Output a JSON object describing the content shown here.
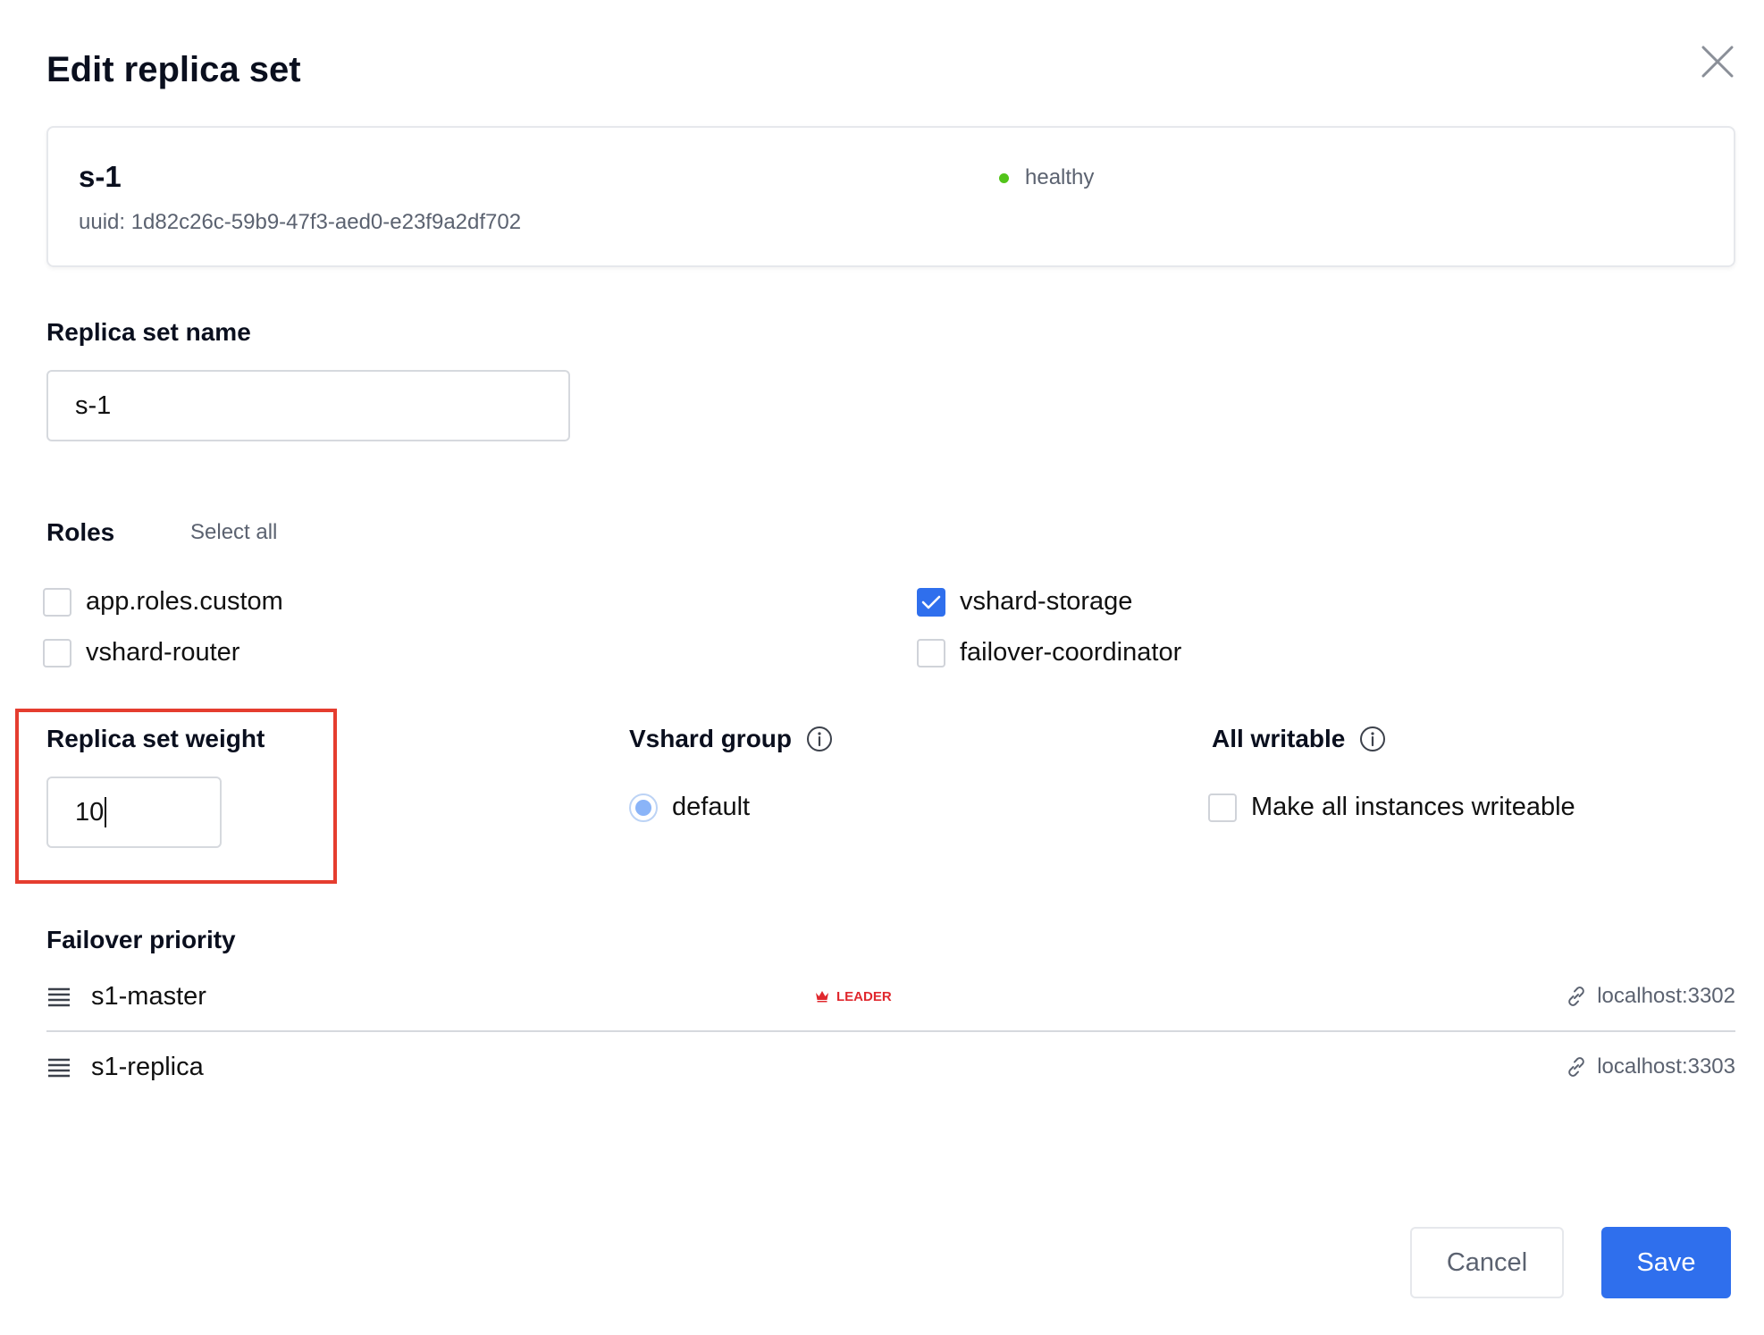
{
  "dialog": {
    "title": "Edit replica set"
  },
  "summary": {
    "name": "s-1",
    "uuid": "uuid: 1d82c26c-59b9-47f3-aed0-e23f9a2df702",
    "status": "healthy",
    "status_color": "#52c41a"
  },
  "name_field": {
    "label": "Replica set name",
    "value": "s-1"
  },
  "roles": {
    "label": "Roles",
    "select_all": "Select all",
    "items": [
      {
        "label": "app.roles.custom",
        "checked": false
      },
      {
        "label": "vshard-storage",
        "checked": true
      },
      {
        "label": "vshard-router",
        "checked": false
      },
      {
        "label": "failover-coordinator",
        "checked": false
      }
    ]
  },
  "weight": {
    "label": "Replica set weight",
    "value": "10"
  },
  "vshard_group": {
    "label": "Vshard group",
    "option": "default",
    "selected": true
  },
  "all_writable": {
    "label": "All writable",
    "option": "Make all instances writeable",
    "checked": false
  },
  "failover": {
    "label": "Failover priority",
    "items": [
      {
        "name": "s1-master",
        "badge": "LEADER",
        "uri": "localhost:3302"
      },
      {
        "name": "s1-replica",
        "badge": "",
        "uri": "localhost:3303"
      }
    ]
  },
  "buttons": {
    "cancel": "Cancel",
    "save": "Save"
  },
  "colors": {
    "accent": "#2f6fed",
    "leader": "#e0282e",
    "highlight": "#e53d2f",
    "radio": "#8ab4f8"
  }
}
